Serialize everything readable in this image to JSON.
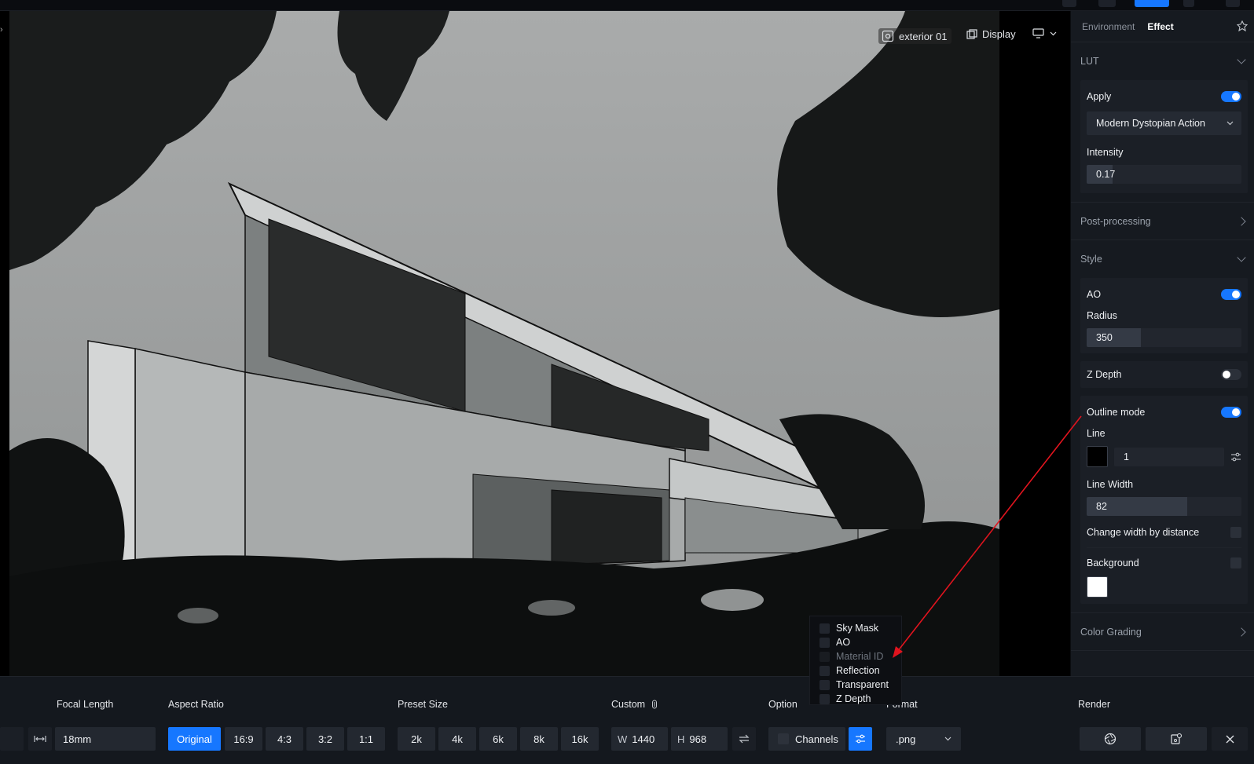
{
  "viewport": {
    "camera_label": "exterior 01",
    "display_label": "Display"
  },
  "panel": {
    "tabs": [
      "Environment",
      "Effect"
    ],
    "active_tab": "Effect",
    "lut": {
      "title": "LUT",
      "apply_label": "Apply",
      "apply_on": true,
      "preset": "Modern Dystopian Action",
      "intensity_label": "Intensity",
      "intensity_value": "0.17",
      "intensity_fraction": 0.17
    },
    "post_processing": {
      "title": "Post-processing"
    },
    "style": {
      "title": "Style",
      "ao_label": "AO",
      "ao_on": true,
      "radius_label": "Radius",
      "radius_value": "350",
      "radius_fraction": 0.35,
      "zdepth_label": "Z Depth",
      "zdepth_on": false,
      "outline_label": "Outline mode",
      "outline_on": true,
      "line_label": "Line",
      "line_color": "#000000",
      "line_value": "1",
      "line_width_label": "Line Width",
      "line_width_value": "82",
      "line_width_fraction": 0.65,
      "change_width_label": "Change width by distance",
      "background_label": "Background",
      "background_color": "#ffffff"
    },
    "color_grading": {
      "title": "Color Grading"
    }
  },
  "bottom": {
    "focal_length": {
      "label": "Focal Length",
      "value": "18mm"
    },
    "aspect_ratio": {
      "label": "Aspect Ratio",
      "options": [
        "Original",
        "16:9",
        "4:3",
        "3:2",
        "1:1"
      ],
      "selected": "Original"
    },
    "preset_size": {
      "label": "Preset Size",
      "options": [
        "2k",
        "4k",
        "6k",
        "8k",
        "16k"
      ]
    },
    "custom": {
      "label": "Custom",
      "w_label": "W",
      "w_value": "1440",
      "h_label": "H",
      "h_value": "968"
    },
    "option": {
      "label": "Option",
      "channels_label": "Channels"
    },
    "format": {
      "label": "Format",
      "value": ".png"
    },
    "render": {
      "label": "Render"
    }
  },
  "channels_dropdown": {
    "items": [
      {
        "label": "Sky Mask",
        "disabled": false
      },
      {
        "label": "AO",
        "disabled": false
      },
      {
        "label": "Material ID",
        "disabled": true
      },
      {
        "label": "Reflection",
        "disabled": false
      },
      {
        "label": "Transparent",
        "disabled": false
      },
      {
        "label": "Z Depth",
        "disabled": false
      }
    ]
  },
  "colors": {
    "accent": "#1677ff",
    "annotation_arrow": "#e0141e"
  }
}
